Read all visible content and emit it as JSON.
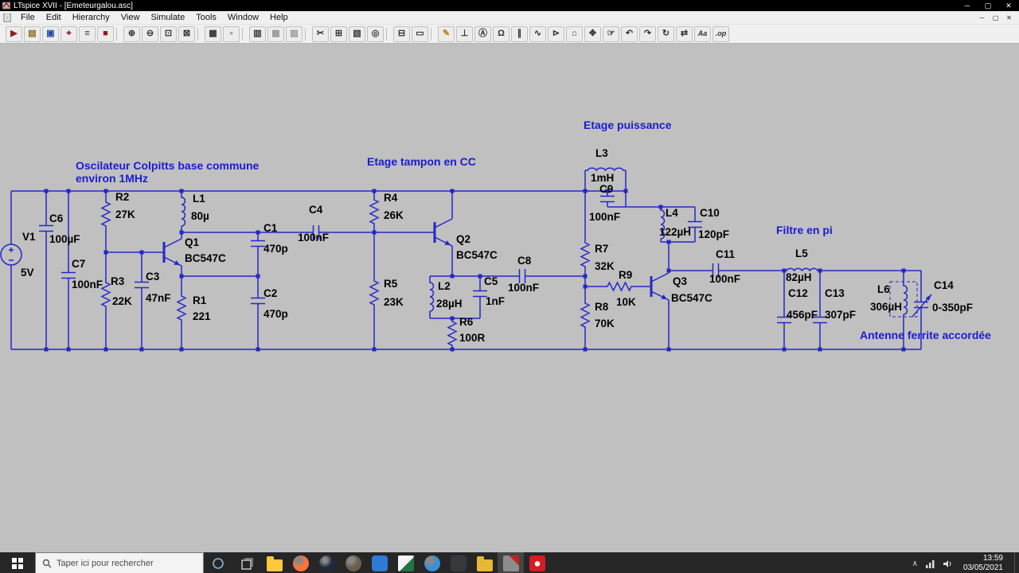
{
  "window": {
    "title": "LTspice XVII - [Emeteurgalou.asc]",
    "controls": [
      {
        "name": "minimize",
        "glyph": "─"
      },
      {
        "name": "maximize",
        "glyph": "▢"
      },
      {
        "name": "close",
        "glyph": "✕"
      }
    ]
  },
  "menu": {
    "items": [
      "File",
      "Edit",
      "Hierarchy",
      "View",
      "Simulate",
      "Tools",
      "Window",
      "Help"
    ]
  },
  "toolbar": {
    "icons": [
      {
        "name": "run",
        "glyph": "▶",
        "color": "#8a1f1f"
      },
      {
        "name": "open",
        "glyph": "▤",
        "color": "#8a6d1f"
      },
      {
        "name": "save",
        "glyph": "▣",
        "color": "#1f4fa0"
      },
      {
        "name": "probe",
        "glyph": "⌖",
        "color": "#8a1f1f"
      },
      {
        "name": "control-panel",
        "glyph": "≡"
      },
      {
        "name": "halt",
        "glyph": "■",
        "color": "#8a1f1f"
      },
      {
        "name": "sep"
      },
      {
        "name": "zoom-in",
        "glyph": "⊕"
      },
      {
        "name": "zoom-out",
        "glyph": "⊖"
      },
      {
        "name": "zoom-full",
        "glyph": "⊡"
      },
      {
        "name": "zoom-redraw",
        "glyph": "⊠"
      },
      {
        "name": "sep"
      },
      {
        "name": "grid",
        "glyph": "▦"
      },
      {
        "name": "snap",
        "glyph": "▫"
      },
      {
        "name": "sep"
      },
      {
        "name": "duplicate",
        "glyph": "▥"
      },
      {
        "name": "paste-left",
        "glyph": "▩",
        "color": "#999999"
      },
      {
        "name": "paste-right",
        "glyph": "▨",
        "color": "#999999"
      },
      {
        "name": "sep"
      },
      {
        "name": "cut",
        "glyph": "✂"
      },
      {
        "name": "copy",
        "glyph": "⊞"
      },
      {
        "name": "paste",
        "glyph": "▧"
      },
      {
        "name": "find",
        "glyph": "◎"
      },
      {
        "name": "sep"
      },
      {
        "name": "print",
        "glyph": "⊟"
      },
      {
        "name": "print-preview",
        "glyph": "▭"
      },
      {
        "name": "sep"
      },
      {
        "name": "wire",
        "glyph": "✎",
        "color": "#b8860b"
      },
      {
        "name": "ground",
        "glyph": "⊥"
      },
      {
        "name": "net-label",
        "glyph": "Ⓐ"
      },
      {
        "name": "resistor",
        "glyph": "Ω"
      },
      {
        "name": "capacitor",
        "glyph": "∥"
      },
      {
        "name": "inductor",
        "glyph": "∿"
      },
      {
        "name": "diode",
        "glyph": "⊳"
      },
      {
        "name": "component",
        "glyph": "⌂"
      },
      {
        "name": "move",
        "glyph": "✥"
      },
      {
        "name": "drag",
        "glyph": "☞"
      },
      {
        "name": "undo",
        "glyph": "↶"
      },
      {
        "name": "redo",
        "glyph": "↷"
      },
      {
        "name": "rotate",
        "glyph": "↻"
      },
      {
        "name": "mirror",
        "glyph": "⇄"
      },
      {
        "name": "text",
        "glyph": "Aa",
        "small": true
      },
      {
        "name": "spice-directive",
        "glyph": ".op",
        "small": true
      }
    ]
  },
  "schematic": {
    "background": "#c0c0c0",
    "wire_color": "#2626c9",
    "label_color": "#000000",
    "comment_color": "#1b1bd1",
    "comments": [
      "Oscilateur Colpitts base commune",
      "environ 1MHz",
      "Etage tampon en CC",
      "Etage puissance",
      "Filtre en pi",
      "Antenne ferrite accordée"
    ],
    "components": [
      {
        "ref": "V1",
        "value": "5V"
      },
      {
        "ref": "C6",
        "value": "100µF"
      },
      {
        "ref": "C7",
        "value": "100nF"
      },
      {
        "ref": "R2",
        "value": "27K"
      },
      {
        "ref": "R3",
        "value": "22K"
      },
      {
        "ref": "C3",
        "value": "47nF"
      },
      {
        "ref": "Q1",
        "value": "BC547C"
      },
      {
        "ref": "L1",
        "value": "80µ"
      },
      {
        "ref": "R1",
        "value": "221"
      },
      {
        "ref": "C1",
        "value": "470p"
      },
      {
        "ref": "C2",
        "value": "470p"
      },
      {
        "ref": "C4",
        "value": "100nF"
      },
      {
        "ref": "R4",
        "value": "26K"
      },
      {
        "ref": "R5",
        "value": "23K"
      },
      {
        "ref": "Q2",
        "value": "BC547C"
      },
      {
        "ref": "L2",
        "value": "28µH"
      },
      {
        "ref": "C5",
        "value": "1nF"
      },
      {
        "ref": "R6",
        "value": "100R"
      },
      {
        "ref": "C8",
        "value": "100nF"
      },
      {
        "ref": "L3",
        "value": "1mH"
      },
      {
        "ref": "C9",
        "value": "100nF"
      },
      {
        "ref": "R7",
        "value": "32K"
      },
      {
        "ref": "R8",
        "value": "70K"
      },
      {
        "ref": "R9",
        "value": "10K"
      },
      {
        "ref": "L4",
        "value": "122µH"
      },
      {
        "ref": "C10",
        "value": "120pF"
      },
      {
        "ref": "Q3",
        "value": "BC547C"
      },
      {
        "ref": "C11",
        "value": "100nF"
      },
      {
        "ref": "L5",
        "value": "82µH"
      },
      {
        "ref": "C12",
        "value": "456pF"
      },
      {
        "ref": "C13",
        "value": "307pF"
      },
      {
        "ref": "L6",
        "value": "306µH"
      },
      {
        "ref": "C14",
        "value": "0-350pF"
      }
    ]
  },
  "taskbar": {
    "search_placeholder": "Taper ici pour rechercher",
    "apps": [
      {
        "name": "file-explorer",
        "style": "folder",
        "color": "#ffc83d"
      },
      {
        "name": "firefox",
        "style": "circle",
        "color": "#ff7139"
      },
      {
        "name": "steam",
        "style": "circle",
        "color": "#1e2a3a"
      },
      {
        "name": "gimp",
        "style": "circle",
        "color": "#6b5d4f"
      },
      {
        "name": "vscode",
        "style": "square",
        "color": "#2c7bd6"
      },
      {
        "name": "excel",
        "style": "sheet",
        "color": "#217346"
      },
      {
        "name": "edge",
        "style": "circle",
        "color": "#3a8fd9"
      },
      {
        "name": "media-player",
        "style": "square",
        "color": "#35393d"
      },
      {
        "name": "documents-folder",
        "style": "folder",
        "color": "#e5b838"
      },
      {
        "name": "ltspice",
        "style": "chip",
        "color": "#a8a8a8",
        "active": true
      },
      {
        "name": "acrobat",
        "style": "pdf",
        "color": "#d41c24"
      }
    ],
    "tray": {
      "expand_glyph": "∧",
      "time": "13:59",
      "date": "03/05/2021"
    }
  }
}
